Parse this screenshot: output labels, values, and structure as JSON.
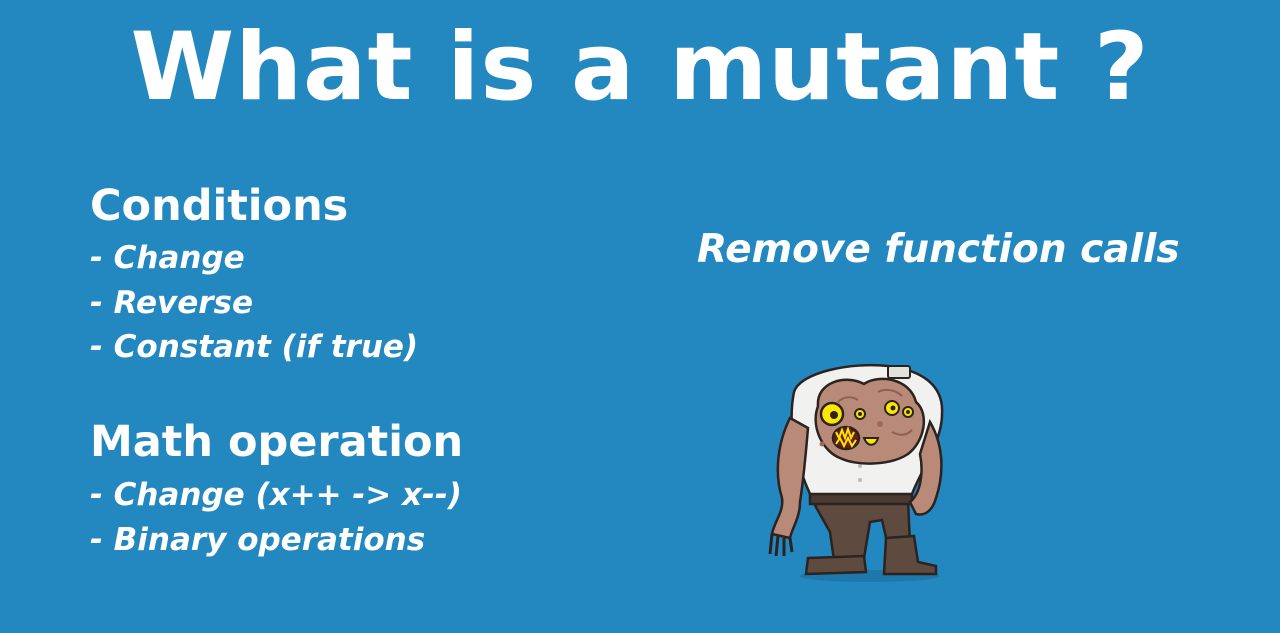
{
  "slide": {
    "background_color": "#2387c0",
    "title": "What is a mutant ?",
    "sections": [
      {
        "heading": "Conditions",
        "items": [
          "- Change",
          "- Reverse",
          "- Constant (if true)"
        ]
      },
      {
        "heading": "Math operation",
        "items": [
          "- Change (x++ -> x--)",
          "- Binary operations"
        ]
      }
    ],
    "side_text": "Remove function calls",
    "illustration": {
      "icon": "two-headed-mutant-cartoon",
      "colors": {
        "skin": "#b98a78",
        "shirt": "#f1f1ef",
        "pants": "#5e4a3f",
        "eyes": "#ffe600",
        "outline": "#2b2320"
      }
    }
  }
}
